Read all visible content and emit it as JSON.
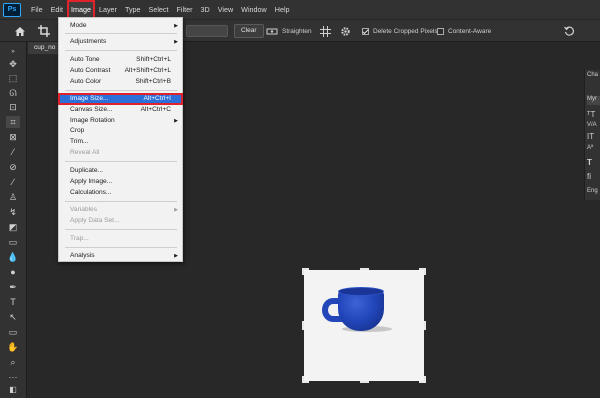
{
  "app": {
    "logo": "Ps"
  },
  "menubar": {
    "items": [
      "File",
      "Edit",
      "Image",
      "Layer",
      "Type",
      "Select",
      "Filter",
      "3D",
      "View",
      "Window",
      "Help"
    ],
    "active": "Image"
  },
  "options_bar": {
    "clear_label": "Clear",
    "straighten_label": "Straighten",
    "delete_cropped_label": "Delete Cropped Pixels",
    "delete_cropped_checked": true,
    "content_aware_label": "Content-Aware",
    "content_aware_checked": false
  },
  "document": {
    "tab_label": "cup_no"
  },
  "image_menu": {
    "mode": "Mode",
    "adjustments": "Adjustments",
    "auto_tone": {
      "label": "Auto Tone",
      "shortcut": "Shift+Ctrl+L"
    },
    "auto_contrast": {
      "label": "Auto Contrast",
      "shortcut": "Alt+Shift+Ctrl+L"
    },
    "auto_color": {
      "label": "Auto Color",
      "shortcut": "Shift+Ctrl+B"
    },
    "image_size": {
      "label": "Image Size...",
      "shortcut": "Alt+Ctrl+I"
    },
    "canvas_size": {
      "label": "Canvas Size...",
      "shortcut": "Alt+Ctrl+C"
    },
    "image_rotation": "Image Rotation",
    "crop": "Crop",
    "trim": "Trim...",
    "reveal_all": "Reveal All",
    "duplicate": "Duplicate...",
    "apply_image": "Apply Image...",
    "calculations": "Calculations...",
    "variables": "Variables",
    "apply_data_set": "Apply Data Set...",
    "trap": "Trap...",
    "analysis": "Analysis"
  },
  "right_panel": {
    "tab": "Cha",
    "font_field": "Myr",
    "lang": "Eng"
  },
  "icons": {
    "home": "home-icon",
    "crop": "crop-tool-icon",
    "grid": "grid-overlay-icon",
    "gear": "gear-icon",
    "undo": "reset-icon"
  },
  "colors": {
    "accent": "#2d6fd8",
    "highlight_border": "#e0232a"
  }
}
